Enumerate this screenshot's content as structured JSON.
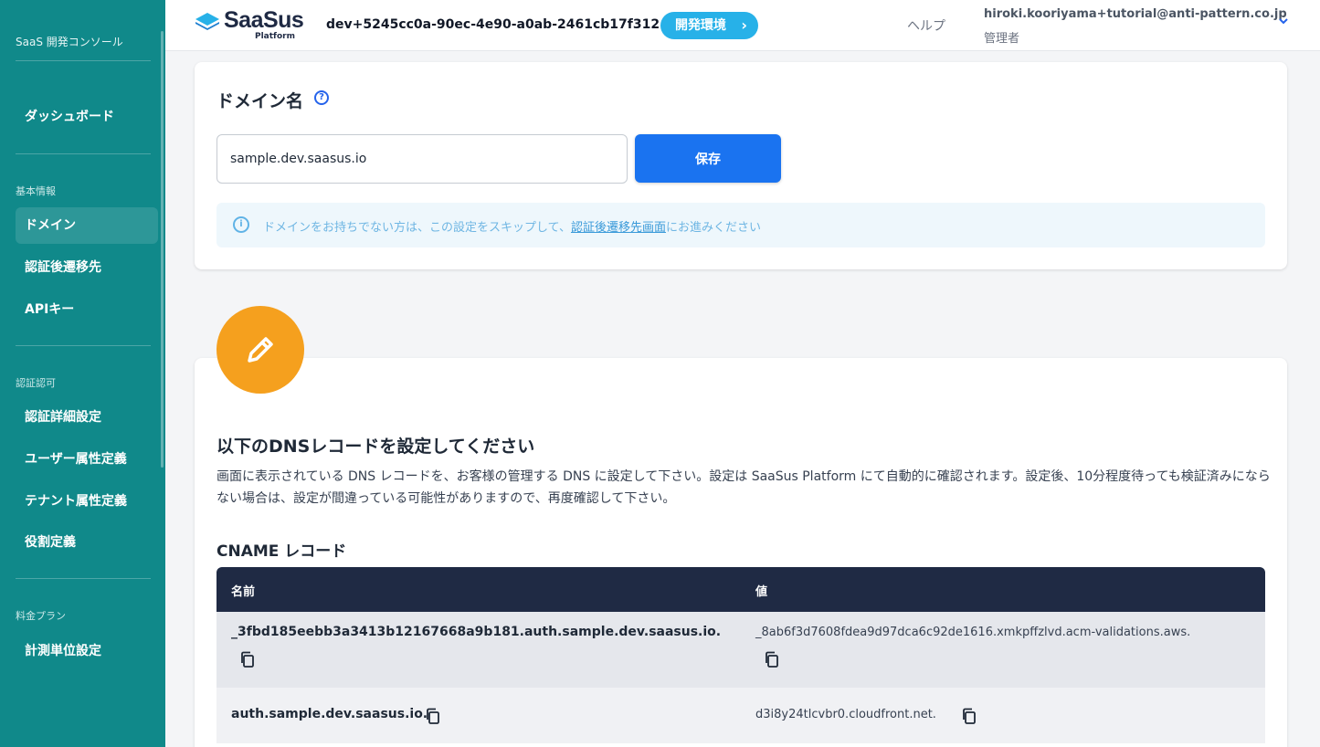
{
  "sidebar": {
    "app_title": "SaaS 開発コンソール",
    "dashboard": "ダッシュボード",
    "sections": [
      {
        "label": "基本情報",
        "items": [
          "ドメイン",
          "認証後遷移先",
          "APIキー"
        ]
      },
      {
        "label": "認証認可",
        "items": [
          "認証詳細設定",
          "ユーザー属性定義",
          "テナント属性定義",
          "役割定義"
        ]
      },
      {
        "label": "料金プラン",
        "items": [
          "計測単位設定"
        ]
      }
    ],
    "active_item": "ドメイン"
  },
  "header": {
    "logo_text": "SaaSus",
    "logo_sub": "Platform",
    "env_id": "dev+5245cc0a-90ec-4e90-a0ab-2461cb17f312",
    "env_button": "開発環境",
    "help": "ヘルプ",
    "user_email": "hiroki.kooriyama+tutorial@anti-pattern.co.jp",
    "user_role": "管理者"
  },
  "domain_card": {
    "title": "ドメイン名",
    "input_value": "sample.dev.saasus.io",
    "save_label": "保存",
    "info_text_before": "ドメインをお持ちでない方は、この設定をスキップして、",
    "info_link": "認証後遷移先画面",
    "info_text_after": "にお進みください"
  },
  "dns_card": {
    "title": "以下のDNSレコードを設定してください",
    "description": "画面に表示されている DNS レコードを、お客様の管理する DNS に設定して下さい。設定は SaaSus Platform にて自動的に確認されます。設定後、10分程度待っても検証済みにならない場合は、設定が間違っている可能性がありますので、再度確認して下さい。",
    "cname_title": "CNAME レコード",
    "table": {
      "headers": [
        "名前",
        "値"
      ],
      "rows": [
        {
          "name": "_3fbd185eebb3a3413b12167668a9b181.auth.sample.dev.saasus.io.",
          "value": "_8ab6f3d7608fdea9d97dca6c92de1616.xmkpffzlvd.acm-validations.aws."
        },
        {
          "name": "auth.sample.dev.saasus.io.",
          "value": "d3i8y24tlcvbr0.cloudfront.net."
        }
      ]
    }
  },
  "colors": {
    "sidebar": "#10898a",
    "accent": "#1a73f0",
    "env_badge": "#27b1e8",
    "pencil_badge": "#f5a01e",
    "table_header": "#1f2a44"
  }
}
